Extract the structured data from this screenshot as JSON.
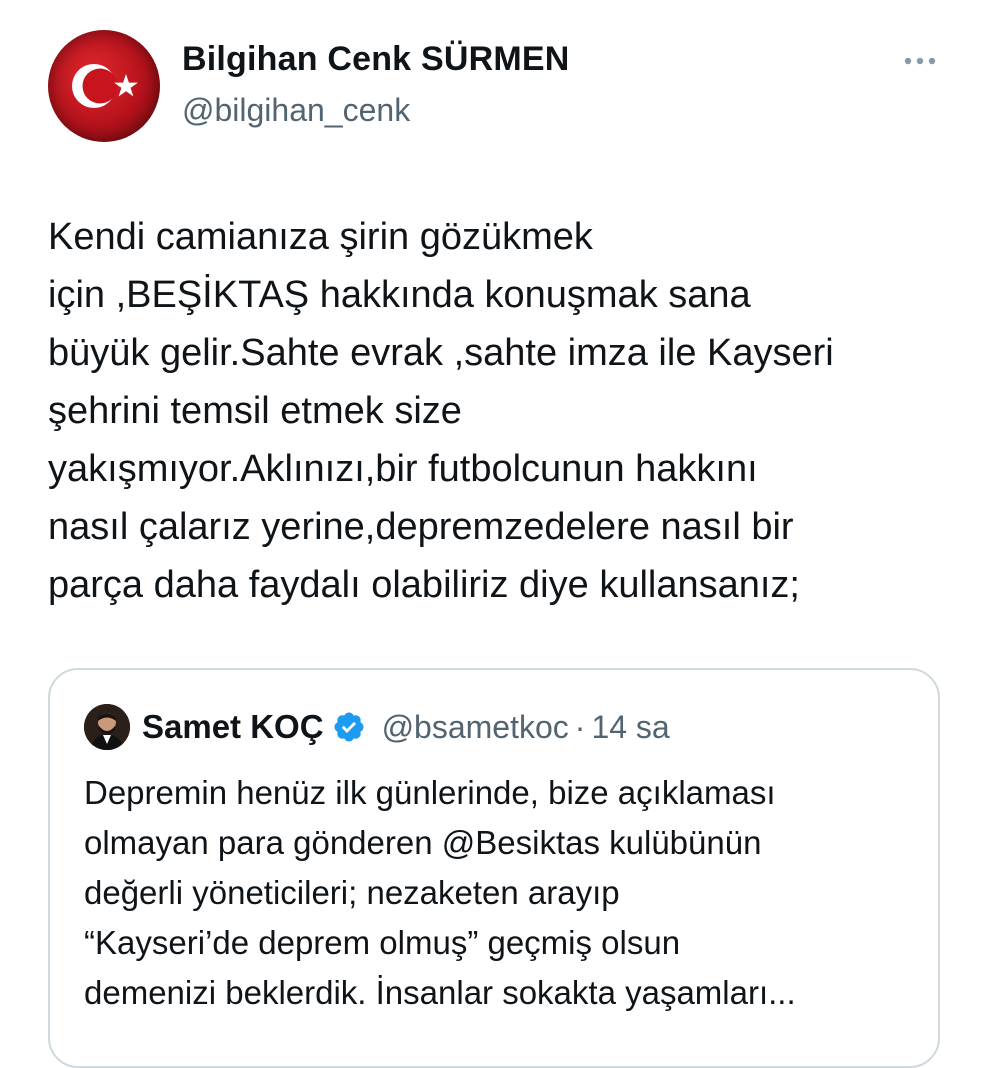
{
  "tweet": {
    "author_name": "Bilgihan Cenk SÜRMEN",
    "author_handle": "@bilgihan_cenk",
    "more_icon": "more-horizontal-icon",
    "avatar_icon": "turkish-flag-avatar",
    "text_lines": [
      "Kendi camianıza şirin gözükmek",
      "için ,BEŞİKTAŞ hakkında konuşmak sana",
      "büyük gelir.Sahte evrak ,sahte imza ile Kayseri",
      "şehrini temsil etmek size",
      "yakışmıyor.Aklınızı,bir futbolcunun hakkını",
      "nasıl çalarız yerine,depremzedelere nasıl bir",
      "parça daha faydalı olabiliriz diye kullansanız;"
    ]
  },
  "quote": {
    "author_name": "Samet KOÇ",
    "verified_icon": "verified-badge-icon",
    "author_handle": "@bsametkoc",
    "separator": "·",
    "time": "14 sa",
    "text_lines": [
      "Depremin henüz ilk günlerinde, bize açıklaması",
      "olmayan para gönderen @Besiktas kulübünün",
      "değerli yöneticileri; nezaketen arayıp",
      "“Kayseri’de deprem olmuş” geçmiş olsun",
      "demenizi beklerdik. İnsanlar sokakta yaşamları..."
    ]
  },
  "colors": {
    "text_primary": "#0f1419",
    "text_secondary": "#536471",
    "border": "#cfd9de",
    "verified_blue": "#1d9bf0",
    "flag_red": "#e30a17"
  }
}
